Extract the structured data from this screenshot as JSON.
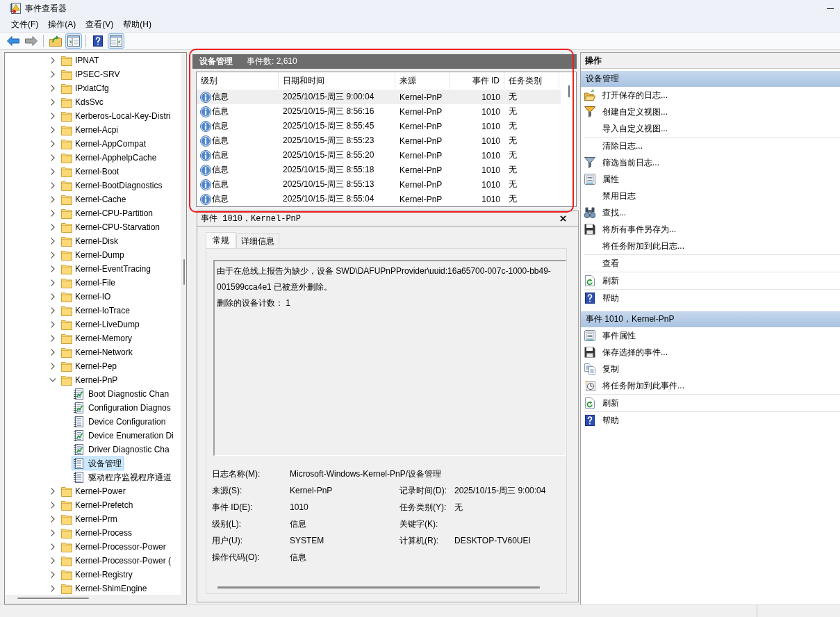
{
  "window": {
    "title": "事件查看器"
  },
  "menu": [
    "文件(F)",
    "操作(A)",
    "查看(V)",
    "帮助(H)"
  ],
  "toolbar": [
    {
      "kind": "back",
      "disabled": false
    },
    {
      "kind": "forward",
      "disabled": true
    },
    {
      "kind": "separator"
    },
    {
      "kind": "up-level"
    },
    {
      "kind": "console-tree",
      "pressed": true
    },
    {
      "kind": "separator"
    },
    {
      "kind": "help"
    },
    {
      "kind": "action-pane",
      "pressed": true
    }
  ],
  "tree": [
    {
      "label": "IPNAT",
      "expanded": false,
      "selected": false
    },
    {
      "label": "IPSEC-SRV",
      "expanded": false,
      "selected": false
    },
    {
      "label": "IPxlatCfg",
      "expanded": false,
      "selected": false
    },
    {
      "label": "KdsSvc",
      "expanded": false,
      "selected": false
    },
    {
      "label": "Kerberos-Local-Key-Distri",
      "expanded": false,
      "selected": false
    },
    {
      "label": "Kernel-Acpi",
      "expanded": false,
      "selected": false
    },
    {
      "label": "Kernel-AppCompat",
      "expanded": false,
      "selected": false
    },
    {
      "label": "Kernel-ApphelpCache",
      "expanded": false,
      "selected": false
    },
    {
      "label": "Kernel-Boot",
      "expanded": false,
      "selected": false
    },
    {
      "label": "Kernel-BootDiagnostics",
      "expanded": false,
      "selected": false
    },
    {
      "label": "Kernel-Cache",
      "expanded": false,
      "selected": false
    },
    {
      "label": "Kernel-CPU-Partition",
      "expanded": false,
      "selected": false
    },
    {
      "label": "Kernel-CPU-Starvation",
      "expanded": false,
      "selected": false
    },
    {
      "label": "Kernel-Disk",
      "expanded": false,
      "selected": false
    },
    {
      "label": "Kernel-Dump",
      "expanded": false,
      "selected": false
    },
    {
      "label": "Kernel-EventTracing",
      "expanded": false,
      "selected": false
    },
    {
      "label": "Kernel-File",
      "expanded": false,
      "selected": false
    },
    {
      "label": "Kernel-IO",
      "expanded": false,
      "selected": false
    },
    {
      "label": "Kernel-IoTrace",
      "expanded": false,
      "selected": false
    },
    {
      "label": "Kernel-LiveDump",
      "expanded": false,
      "selected": false
    },
    {
      "label": "Kernel-Memory",
      "expanded": false,
      "selected": false
    },
    {
      "label": "Kernel-Network",
      "expanded": false,
      "selected": false
    },
    {
      "label": "Kernel-Pep",
      "expanded": false,
      "selected": false
    },
    {
      "label": "Kernel-PnP",
      "expanded": true,
      "selected": false,
      "children": [
        {
          "label": "Boot Diagnostic Chan",
          "kind": "diagnostic",
          "selected": false
        },
        {
          "label": "Configuration Diagnos",
          "kind": "diagnostic",
          "selected": false
        },
        {
          "label": "Device Configuration",
          "kind": "channel",
          "selected": false
        },
        {
          "label": "Device Enumeration Di",
          "kind": "diagnostic",
          "selected": false
        },
        {
          "label": "Driver Diagnostic Cha",
          "kind": "diagnostic",
          "selected": false
        },
        {
          "label": "设备管理",
          "kind": "channel",
          "selected": true
        },
        {
          "label": "驱动程序监视程序通道",
          "kind": "channel",
          "selected": false
        }
      ]
    },
    {
      "label": "Kernel-Power",
      "expanded": false,
      "selected": false
    },
    {
      "label": "Kernel-Prefetch",
      "expanded": false,
      "selected": false
    },
    {
      "label": "Kernel-Prm",
      "expanded": false,
      "selected": false
    },
    {
      "label": "Kernel-Process",
      "expanded": false,
      "selected": false
    },
    {
      "label": "Kernel-Processor-Power",
      "expanded": false,
      "selected": false
    },
    {
      "label": "Kernel-Processor-Power (",
      "expanded": false,
      "selected": false
    },
    {
      "label": "Kernel-Registry",
      "expanded": false,
      "selected": false
    },
    {
      "label": "Kernel-ShimEngine",
      "expanded": false,
      "selected": false
    }
  ],
  "event_list": {
    "title": "设备管理",
    "count": "事件数: 2,610",
    "highlighted": true,
    "columns": [
      "级别",
      "日期和时间",
      "来源",
      "事件 ID",
      "任务类别"
    ],
    "rows": [
      {
        "kind": "information",
        "level": "信息",
        "datetime": "2025/10/15-周三 9:00:04",
        "source": "Kernel-PnP",
        "event_id": "1010",
        "task": "无",
        "selected": true
      },
      {
        "kind": "information",
        "level": "信息",
        "datetime": "2025/10/15-周三 8:56:16",
        "source": "Kernel-PnP",
        "event_id": "1010",
        "task": "无",
        "selected": false
      },
      {
        "kind": "information",
        "level": "信息",
        "datetime": "2025/10/15-周三 8:55:45",
        "source": "Kernel-PnP",
        "event_id": "1010",
        "task": "无",
        "selected": false
      },
      {
        "kind": "information",
        "level": "信息",
        "datetime": "2025/10/15-周三 8:55:23",
        "source": "Kernel-PnP",
        "event_id": "1010",
        "task": "无",
        "selected": false
      },
      {
        "kind": "information",
        "level": "信息",
        "datetime": "2025/10/15-周三 8:55:20",
        "source": "Kernel-PnP",
        "event_id": "1010",
        "task": "无",
        "selected": false
      },
      {
        "kind": "information",
        "level": "信息",
        "datetime": "2025/10/15-周三 8:55:18",
        "source": "Kernel-PnP",
        "event_id": "1010",
        "task": "无",
        "selected": false
      },
      {
        "kind": "information",
        "level": "信息",
        "datetime": "2025/10/15-周三 8:55:13",
        "source": "Kernel-PnP",
        "event_id": "1010",
        "task": "无",
        "selected": false
      },
      {
        "kind": "information",
        "level": "信息",
        "datetime": "2025/10/15-周三 8:55:04",
        "source": "Kernel-PnP",
        "event_id": "1010",
        "task": "无",
        "selected": false
      }
    ]
  },
  "event_detail": {
    "title": "事件 1010，Kernel-PnP",
    "tabs": [
      {
        "label": "常规",
        "selected": true
      },
      {
        "label": "详细信息",
        "selected": false
      }
    ],
    "message": [
      "由于在总线上报告为缺少，设备 SWD\\DAFUPnPProvider\\uuid:16a65700-007c-1000-bb49-001599cca4e1 已被意外删除。",
      "删除的设备计数： 1"
    ],
    "log_name": {
      "label": "日志名称(M):",
      "value": "Microsoft-Windows-Kernel-PnP/设备管理"
    },
    "fields": [
      [
        {
          "label": "来源(S):",
          "value": "Kernel-PnP"
        },
        {
          "label": "记录时间(D):",
          "value": "2025/10/15-周三 9:00:04"
        }
      ],
      [
        {
          "label": "事件 ID(E):",
          "value": "1010"
        },
        {
          "label": "任务类别(Y):",
          "value": "无"
        }
      ],
      [
        {
          "label": "级别(L):",
          "value": "信息"
        },
        {
          "label": "关键字(K):"
        }
      ],
      [
        {
          "label": "用户(U):",
          "value": "SYSTEM"
        },
        {
          "label": "计算机(R):",
          "value": "DESKTOP-TV60UEI"
        }
      ],
      [
        {
          "label": "操作代码(O):",
          "value": "信息"
        }
      ]
    ]
  },
  "actions": {
    "title": "操作",
    "sections": [
      {
        "title": "设备管理",
        "groups": [
          [
            {
              "label": "打开保存的日志...",
              "kind": "open-log"
            },
            {
              "label": "创建自定义视图...",
              "kind": "create-view"
            },
            {
              "label": "导入自定义视图...",
              "kind": "plain"
            }
          ],
          [
            {
              "label": "清除日志...",
              "kind": "plain"
            },
            {
              "label": "筛选当前日志...",
              "kind": "filter"
            },
            {
              "label": "属性",
              "kind": "properties"
            },
            {
              "label": "禁用日志",
              "kind": "plain"
            },
            {
              "label": "查找...",
              "kind": "find"
            },
            {
              "label": "将所有事件另存为...",
              "kind": "save"
            },
            {
              "label": "将任务附加到此日志...",
              "kind": "plain"
            }
          ],
          [
            {
              "label": "查看",
              "kind": "plain"
            }
          ],
          [
            {
              "label": "刷新",
              "kind": "refresh"
            }
          ],
          [
            {
              "label": "帮助",
              "kind": "help"
            }
          ]
        ]
      },
      {
        "title": "事件 1010，Kernel-PnP",
        "groups": [
          [
            {
              "label": "事件属性",
              "kind": "properties"
            },
            {
              "label": "保存选择的事件...",
              "kind": "save"
            },
            {
              "label": "复制",
              "kind": "copy"
            },
            {
              "label": "将任务附加到此事件...",
              "kind": "attach-task"
            }
          ],
          [
            {
              "label": "刷新",
              "kind": "refresh"
            }
          ],
          [
            {
              "label": "帮助",
              "kind": "help"
            }
          ]
        ]
      }
    ]
  }
}
